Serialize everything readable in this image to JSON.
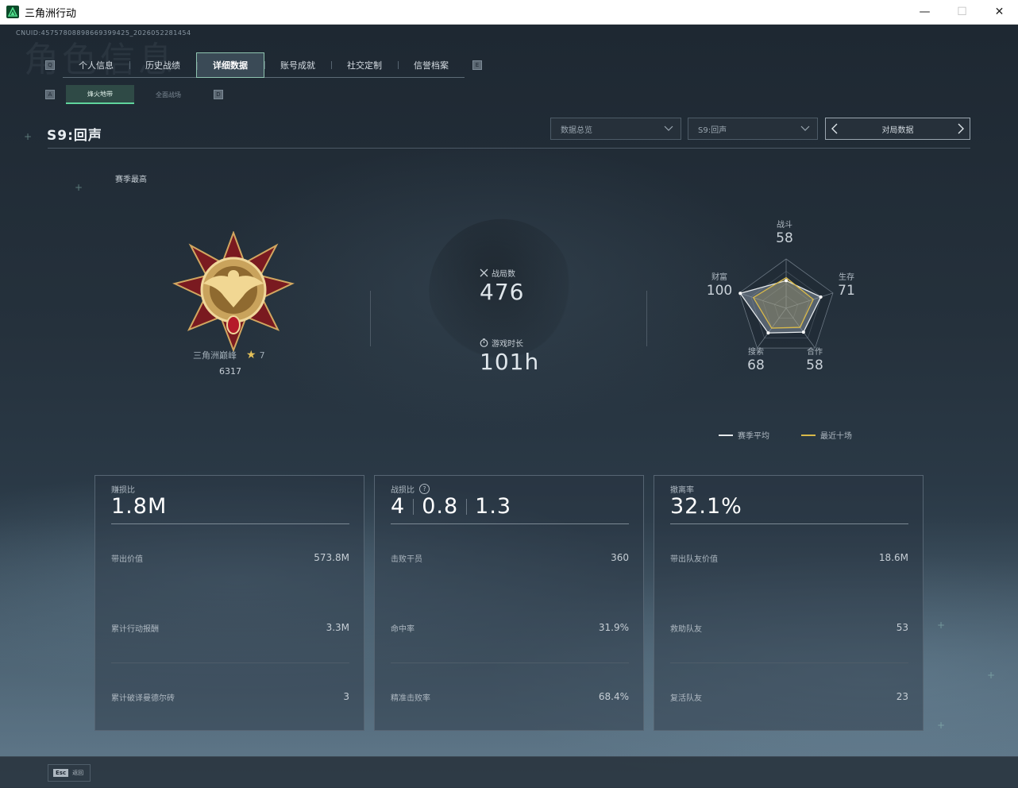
{
  "window": {
    "title": "三角洲行动",
    "min": "—",
    "max": "☐",
    "close": "✕"
  },
  "uid": "CNUID:45757808898669399425_2026052281454",
  "bg_title": "角色信息",
  "tabs": {
    "left_key": "Q",
    "right_key": "E",
    "items": [
      {
        "label": "个人信息"
      },
      {
        "label": "历史战绩"
      },
      {
        "label": "详细数据"
      },
      {
        "label": "账号成就"
      },
      {
        "label": "社交定制"
      },
      {
        "label": "信誉档案"
      }
    ]
  },
  "subtabs": {
    "left_key": "A",
    "right_key": "D",
    "items": [
      {
        "label": "烽火地带"
      },
      {
        "label": "全面战场"
      }
    ]
  },
  "season": "S9:回声",
  "dropdowns": {
    "overview": "数据总览",
    "season": "S9:回声",
    "match": "对局数据"
  },
  "season_high": "赛季最高",
  "rank": {
    "name": "三角洲巅峰",
    "stars": "7",
    "score": "6317"
  },
  "stats": {
    "matches_label": "战局数",
    "matches_value": "476",
    "time_label": "游戏时长",
    "time_value": "101h"
  },
  "radar": {
    "axes": [
      {
        "label": "战斗",
        "value": "58"
      },
      {
        "label": "生存",
        "value": "71"
      },
      {
        "label": "合作",
        "value": "58"
      },
      {
        "label": "搜索",
        "value": "68"
      },
      {
        "label": "财富",
        "value": "100"
      }
    ],
    "season_avg": [
      0.56,
      0.74,
      0.6,
      0.62,
      0.98
    ],
    "recent_ten": [
      0.62,
      0.58,
      0.48,
      0.5,
      0.7
    ],
    "colors": {
      "season": "#e5e9ec",
      "recent": "#d8b94a"
    }
  },
  "legend": {
    "season": "赛季平均",
    "recent": "最近十场"
  },
  "cards": [
    {
      "head": "赚损比",
      "big": "1.8M",
      "rows": [
        {
          "label": "带出价值",
          "value": "573.8M"
        },
        {
          "label": "累计行动报酬",
          "value": "3.3M"
        },
        {
          "label": "累计破译曼德尔砖",
          "value": "3"
        }
      ]
    },
    {
      "head": "战损比",
      "help": "?",
      "big_parts": [
        "4",
        "0.8",
        "1.3"
      ],
      "rows": [
        {
          "label": "击败干员",
          "value": "360"
        },
        {
          "label": "命中率",
          "value": "31.9%"
        },
        {
          "label": "精准击败率",
          "value": "68.4%"
        }
      ]
    },
    {
      "head": "撤离率",
      "big": "32.1%",
      "rows": [
        {
          "label": "带出队友价值",
          "value": "18.6M"
        },
        {
          "label": "救助队友",
          "value": "53"
        },
        {
          "label": "复活队友",
          "value": "23"
        }
      ]
    }
  ],
  "esc": {
    "key": "Esc",
    "label": "返回"
  }
}
